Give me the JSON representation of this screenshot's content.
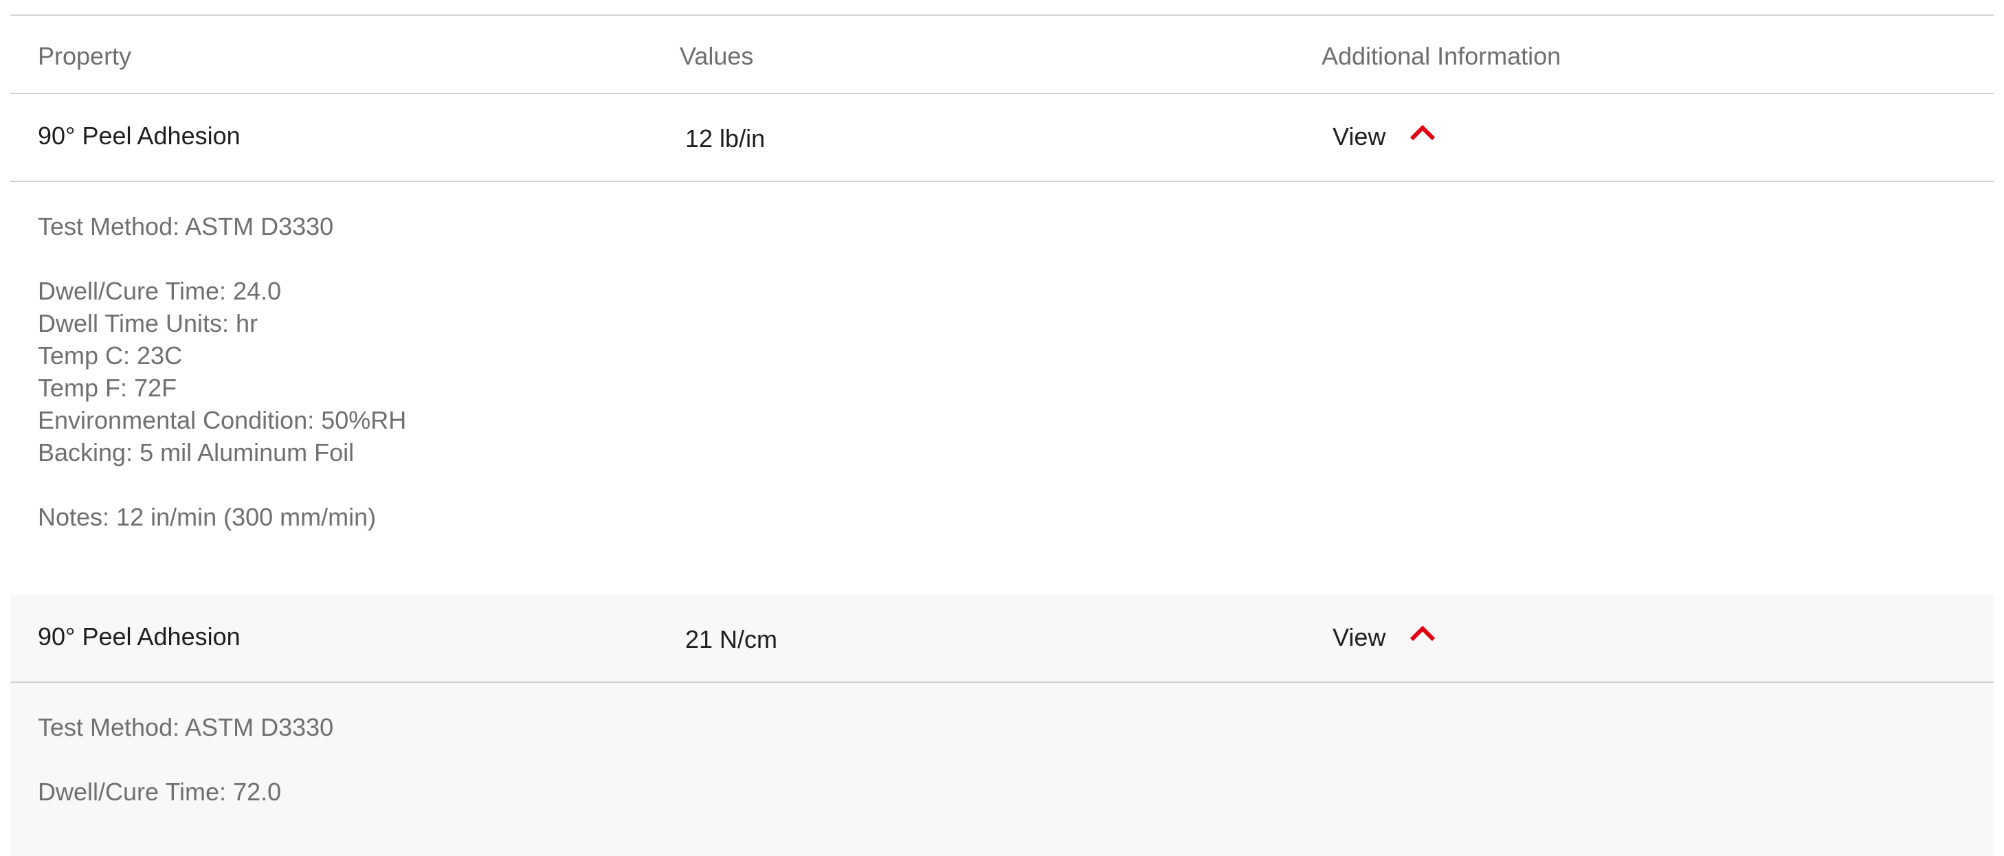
{
  "table": {
    "headers": {
      "property": "Property",
      "values": "Values",
      "additional": "Additional Information"
    },
    "rows": [
      {
        "property": "90° Peel Adhesion",
        "value": "12 lb/in",
        "view_label": "View",
        "toggle_icon": "chevron-up-icon",
        "expanded": true,
        "details": {
          "test_method": "Test Method: ASTM D3330",
          "conditions": [
            "Dwell/Cure Time: 24.0",
            "Dwell Time Units: hr",
            "Temp C: 23C",
            "Temp F: 72F",
            "Environmental Condition: 50%RH",
            "Backing: 5 mil Aluminum Foil"
          ],
          "notes": "Notes: 12 in/min (300 mm/min)"
        }
      },
      {
        "property": "90° Peel Adhesion",
        "value": "21 N/cm",
        "view_label": "View",
        "toggle_icon": "chevron-up-icon",
        "expanded": true,
        "details": {
          "test_method": "Test Method: ASTM D3330",
          "conditions": [
            "Dwell/Cure Time: 72.0"
          ]
        }
      }
    ]
  },
  "colors": {
    "accent": "#e1000f",
    "rule": "#d5d5d5",
    "alt_row": "#f8f8f8",
    "header_text": "#6e6e6e",
    "cell_text": "#1e1e1e",
    "detail_text": "#6f6f6f"
  }
}
